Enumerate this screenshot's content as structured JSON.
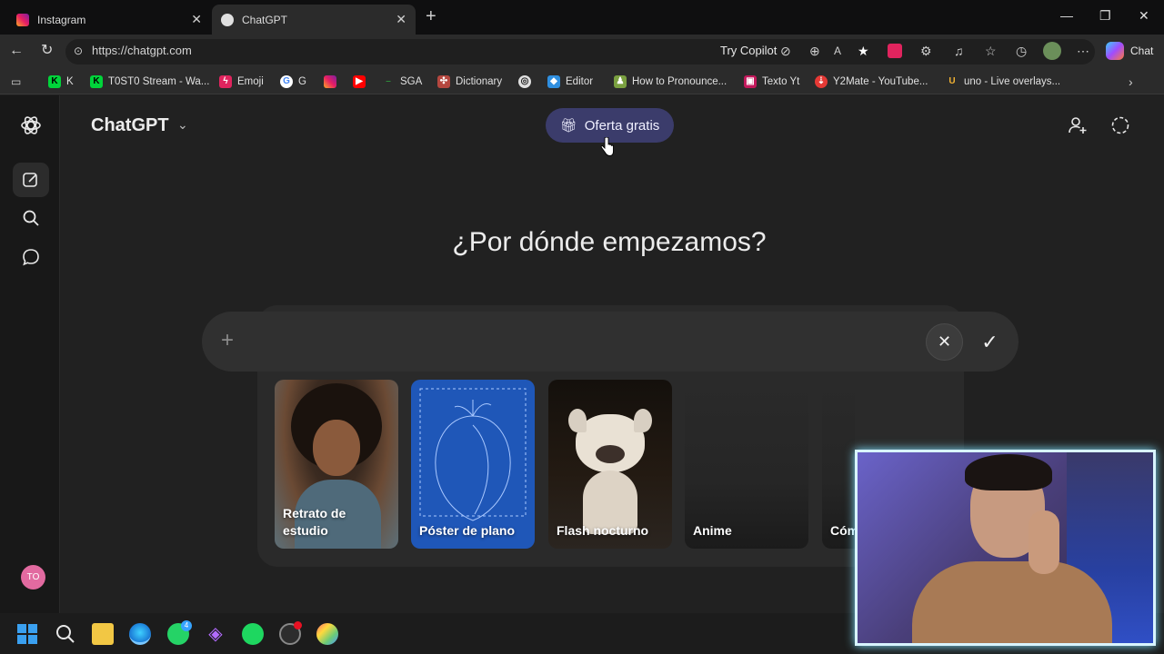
{
  "browser": {
    "tabs": [
      {
        "title": "Instagram",
        "active": false
      },
      {
        "title": "ChatGPT",
        "active": true
      }
    ],
    "url": "https://chatgpt.com",
    "try_copilot": "Try Copilot",
    "chat_label": "Chat",
    "bookmarks": [
      {
        "label": "K",
        "icon": "kick-icon"
      },
      {
        "label": "T0ST0 Stream - Wa...",
        "icon": "kick-icon"
      },
      {
        "label": "Emoji",
        "icon": "emoji-icon"
      },
      {
        "label": "G",
        "icon": "google-icon"
      },
      {
        "label": "",
        "icon": "instagram-icon"
      },
      {
        "label": "",
        "icon": "youtube-icon"
      },
      {
        "label": "SGA",
        "icon": "sga-icon"
      },
      {
        "label": "Dictionary",
        "icon": "dictionary-icon"
      },
      {
        "label": "",
        "icon": "chatgpt-icon"
      },
      {
        "label": "Editor",
        "icon": "editor-icon"
      },
      {
        "label": "How to Pronounce...",
        "icon": "pronounce-icon"
      },
      {
        "label": "Texto Yt",
        "icon": "texto-icon"
      },
      {
        "label": "Y2Mate - YouTube...",
        "icon": "y2mate-icon"
      },
      {
        "label": "uno - Live overlays...",
        "icon": "uno-icon"
      }
    ]
  },
  "app": {
    "brand": "ChatGPT",
    "offer_button": "Oferta gratis",
    "heading": "¿Por dónde empezamos?",
    "avatar_initials": "TO",
    "suggestion_cards": [
      {
        "label": "Retrato de estudio"
      },
      {
        "label": "Póster de plano"
      },
      {
        "label": "Flash nocturno"
      },
      {
        "label": "Anime"
      },
      {
        "label": "Cóm"
      }
    ]
  },
  "colors": {
    "background": "#212121",
    "sidebar": "#181818",
    "offer_button": "#3b3c6b",
    "avatar": "#e26aa0"
  }
}
